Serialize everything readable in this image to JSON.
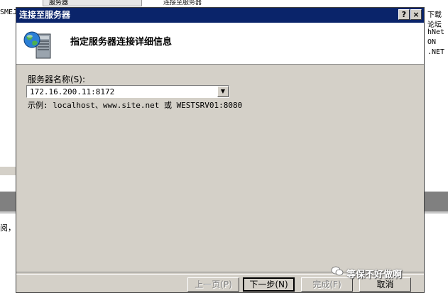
{
  "background": {
    "left_fragment": "SMEJ",
    "tab_label": "服务器",
    "tab2_label": "连接至服务器",
    "right_lines": [
      "下载",
      "论坛",
      "hNet",
      "ON",
      ".NET"
    ],
    "bottom_fragment": "阅，i"
  },
  "dialog": {
    "title": "连接至服务器",
    "help_button": "?",
    "close_button": "×",
    "header_title": "指定服务器连接详细信息",
    "server_label": "服务器名称(S):",
    "server_value": "172.16.200.11:8172",
    "example_text": "示例: localhost、www.site.net 或 WESTSRV01:8080",
    "buttons": {
      "prev": "上一页(P)",
      "next": "下一步(N)",
      "finish": "完成(F)",
      "cancel": "取消"
    }
  },
  "watermark": "等保不好做啊",
  "colors": {
    "titlebar": "#0a246a",
    "dialog_bg": "#d4d0c8"
  }
}
